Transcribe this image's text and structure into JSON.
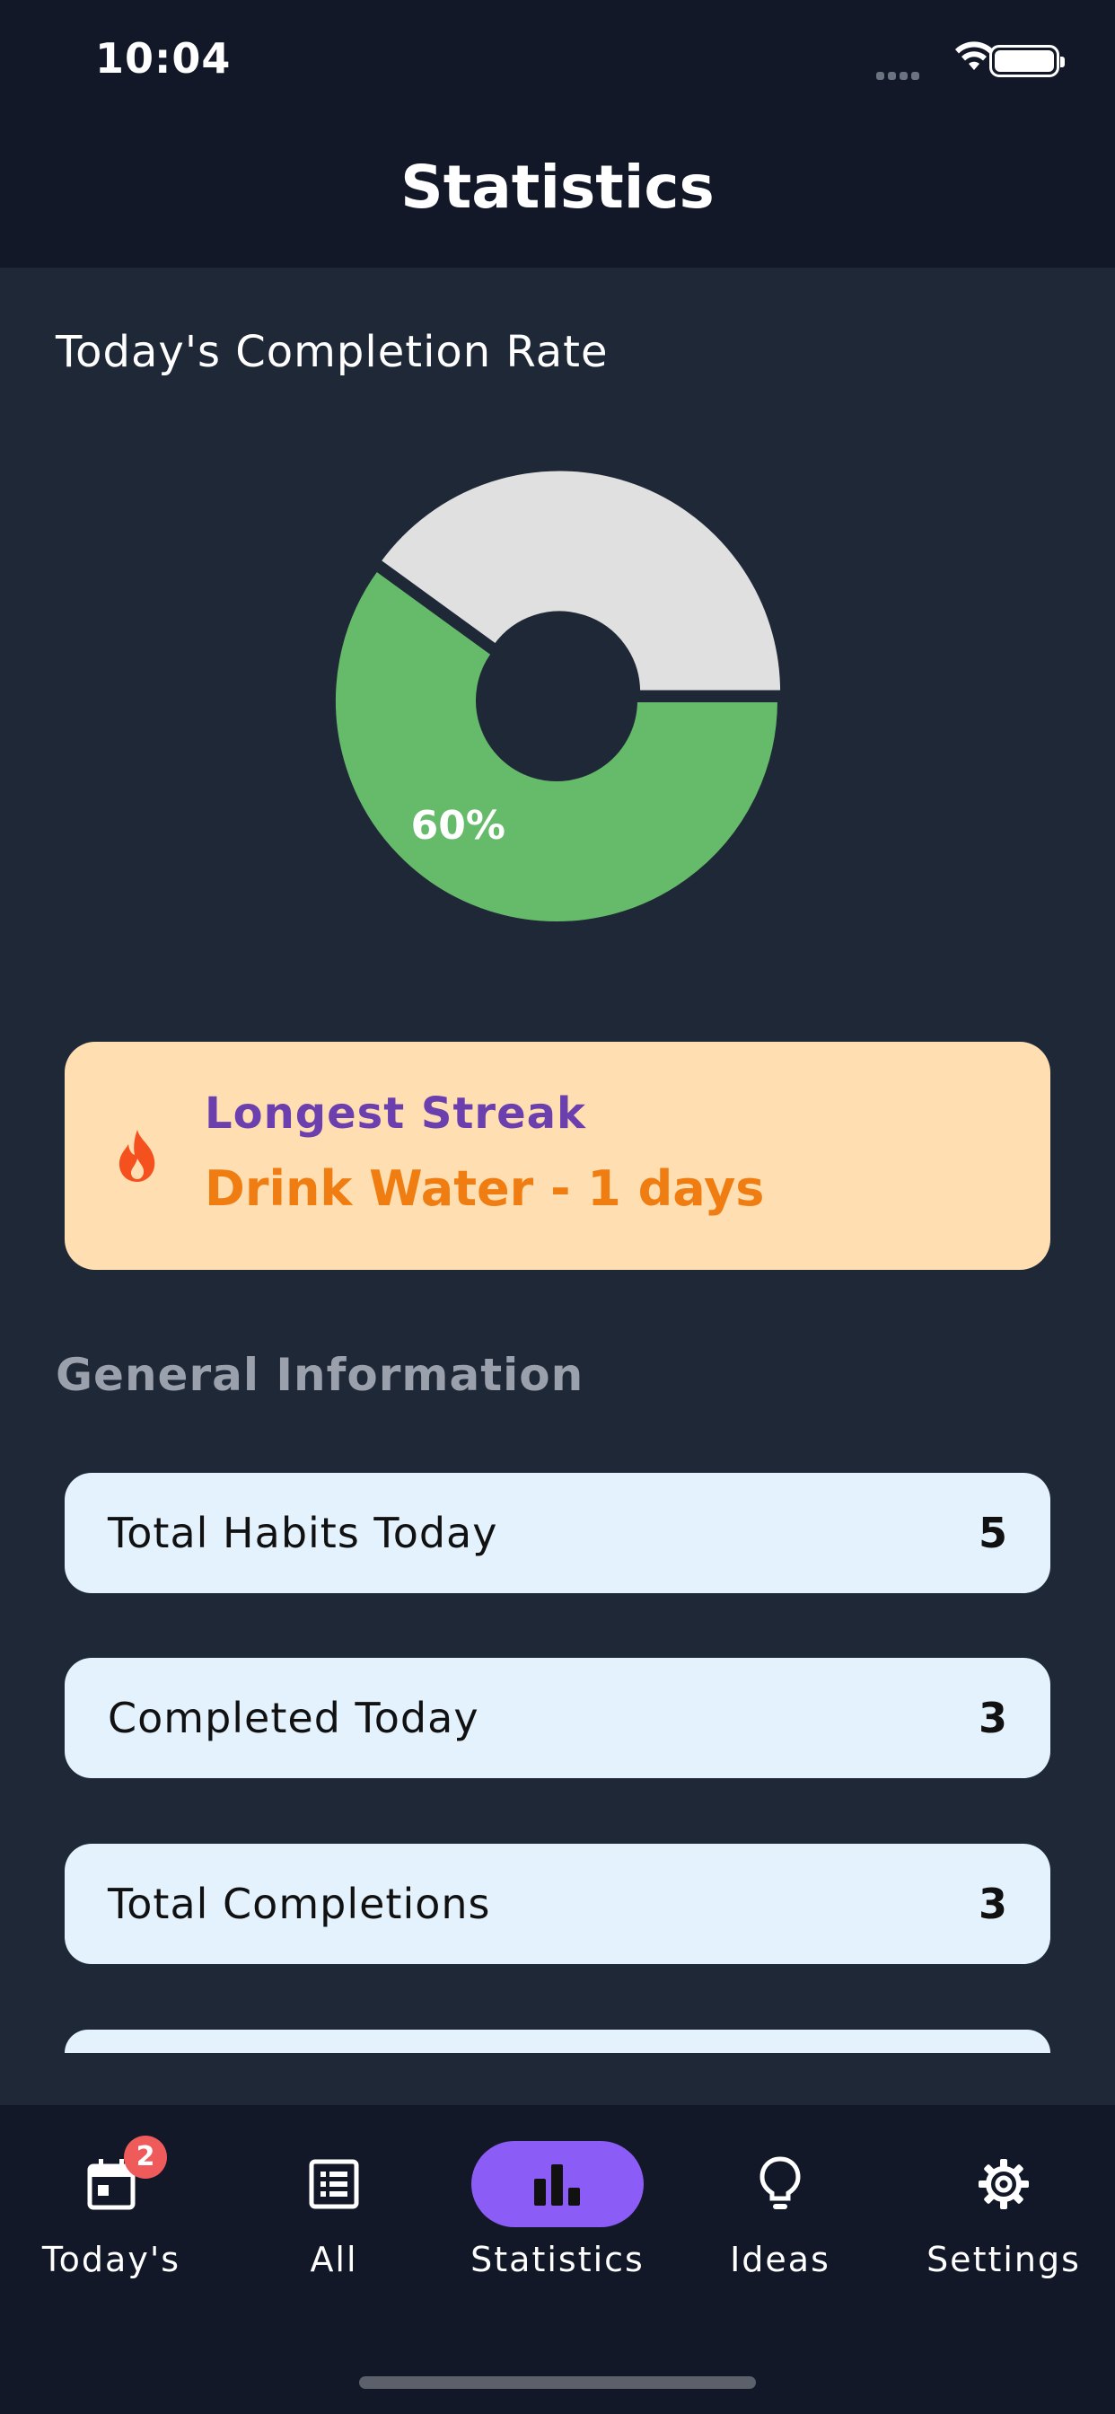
{
  "status_bar": {
    "time": "10:04"
  },
  "header": {
    "title": "Statistics"
  },
  "completion": {
    "heading": "Today's Completion Rate",
    "percent_label": "60%",
    "chart_data": {
      "type": "pie",
      "slices": [
        {
          "label": "Completed",
          "value": 60,
          "color": "#66bb6a"
        },
        {
          "label": "Remaining",
          "value": 40,
          "color": "#e0e0e0"
        }
      ]
    }
  },
  "streak": {
    "label": "Longest Streak",
    "value": "Drink Water - 1 days",
    "icon": "fire-icon"
  },
  "general": {
    "heading": "General Information",
    "rows": [
      {
        "label": "Total Habits Today",
        "value": "5"
      },
      {
        "label": "Completed Today",
        "value": "3"
      },
      {
        "label": "Total Completions",
        "value": "3"
      }
    ]
  },
  "nav": {
    "items": [
      {
        "label": "Today's",
        "icon": "calendar-icon",
        "badge": "2"
      },
      {
        "label": "All",
        "icon": "list-icon"
      },
      {
        "label": "Statistics",
        "icon": "bar-chart-icon",
        "active": true
      },
      {
        "label": "Ideas",
        "icon": "lightbulb-icon"
      },
      {
        "label": "Settings",
        "icon": "gear-icon"
      }
    ]
  },
  "colors": {
    "accent": "#8b5cf6",
    "completed": "#66bb6a",
    "remaining": "#e0e0e0",
    "streak_bg": "#ffdfb1",
    "row_bg": "#e3f2fd"
  }
}
